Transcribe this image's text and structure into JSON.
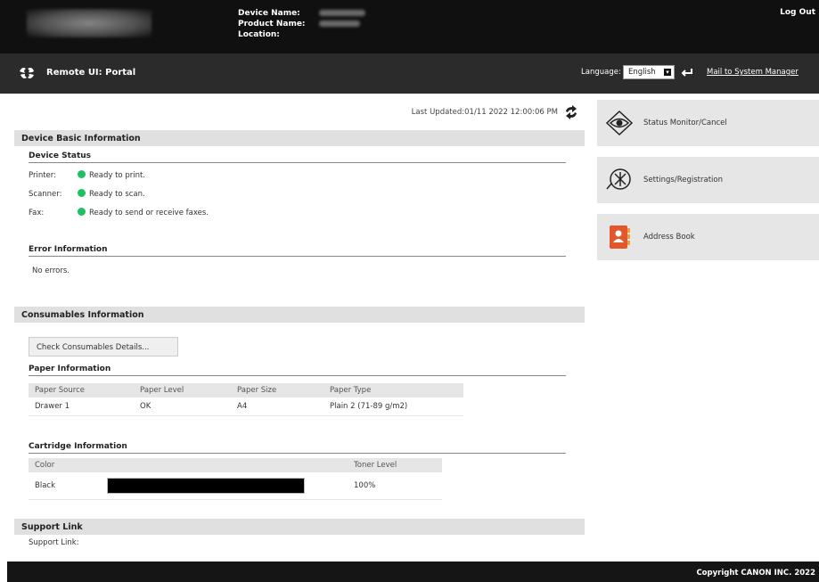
{
  "header": {
    "device_name_label": "Device Name:",
    "product_name_label": "Product Name:",
    "location_label": "Location:",
    "logout": "Log Out"
  },
  "portal": {
    "title": "Remote UI: Portal",
    "language_label": "Language:",
    "language_value": "English",
    "mail_link": "Mail to System Manager"
  },
  "main": {
    "last_updated": "Last Updated:01/11 2022 12:00:06 PM",
    "device_basic": {
      "title": "Device Basic Information",
      "status_title": "Device Status",
      "rows": [
        {
          "label": "Printer:",
          "value": "Ready to print."
        },
        {
          "label": "Scanner:",
          "value": "Ready to scan."
        },
        {
          "label": "Fax:",
          "value": "Ready to send or receive faxes."
        }
      ],
      "error_title": "Error Information",
      "error_text": "No errors."
    },
    "consumables": {
      "title": "Consumables Information",
      "button": "Check Consumables Details...",
      "paper_title": "Paper Information",
      "paper_headers": [
        "Paper Source",
        "Paper Level",
        "Paper Size",
        "Paper Type"
      ],
      "paper_rows": [
        [
          "Drawer 1",
          "OK",
          "A4",
          "Plain 2 (71-89 g/m2)"
        ]
      ],
      "cartridge_title": "Cartridge Information",
      "cartridge_headers": [
        "Color",
        "",
        "Toner Level"
      ],
      "cartridge_rows": [
        {
          "color": "Black",
          "level_text": "100%",
          "level": 1.0
        }
      ]
    },
    "support": {
      "title": "Support Link",
      "label": "Support Link:"
    }
  },
  "menu": {
    "items": [
      {
        "label": "Status Monitor/Cancel",
        "icon": "eye-icon"
      },
      {
        "label": "Settings/Registration",
        "icon": "settings-icon"
      },
      {
        "label": "Address Book",
        "icon": "address-book-icon"
      }
    ]
  },
  "footer": {
    "copyright": "Copyright CANON INC. 2022"
  },
  "colors": {
    "status_ok": "#1fc064",
    "header_bg": "#101010",
    "portal_bg": "#2b2b2b",
    "section_bg": "#e0e0e0",
    "address_book": "#e2572b"
  }
}
